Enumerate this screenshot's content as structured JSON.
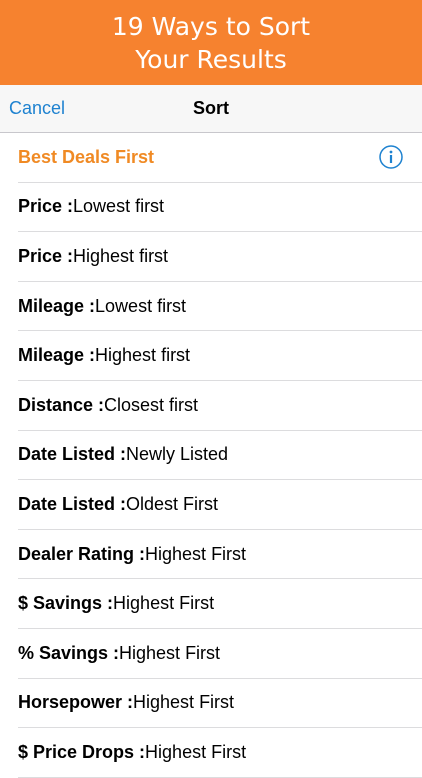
{
  "banner": {
    "line1": "19 Ways to Sort",
    "line2": "Your Results"
  },
  "nav": {
    "cancel_label": "Cancel",
    "title": "Sort"
  },
  "featured": {
    "label": "Best Deals First",
    "icon": "info-icon"
  },
  "options": [
    {
      "key": "Price :",
      "value": " Lowest first"
    },
    {
      "key": "Price :",
      "value": " Highest first"
    },
    {
      "key": "Mileage :",
      "value": " Lowest first"
    },
    {
      "key": "Mileage :",
      "value": " Highest first"
    },
    {
      "key": "Distance :",
      "value": " Closest first"
    },
    {
      "key": "Date Listed :",
      "value": " Newly Listed"
    },
    {
      "key": "Date Listed :",
      "value": " Oldest First"
    },
    {
      "key": "Dealer Rating :",
      "value": " Highest First"
    },
    {
      "key": "$ Savings :",
      "value": " Highest First"
    },
    {
      "key": "% Savings :",
      "value": " Highest First"
    },
    {
      "key": "Horsepower :",
      "value": " Highest First"
    },
    {
      "key": "$ Price Drops :",
      "value": " Highest First"
    }
  ],
  "colors": {
    "banner": "#f6822f",
    "accent_blue": "#1e82d0",
    "highlight_orange": "#f08a24"
  }
}
